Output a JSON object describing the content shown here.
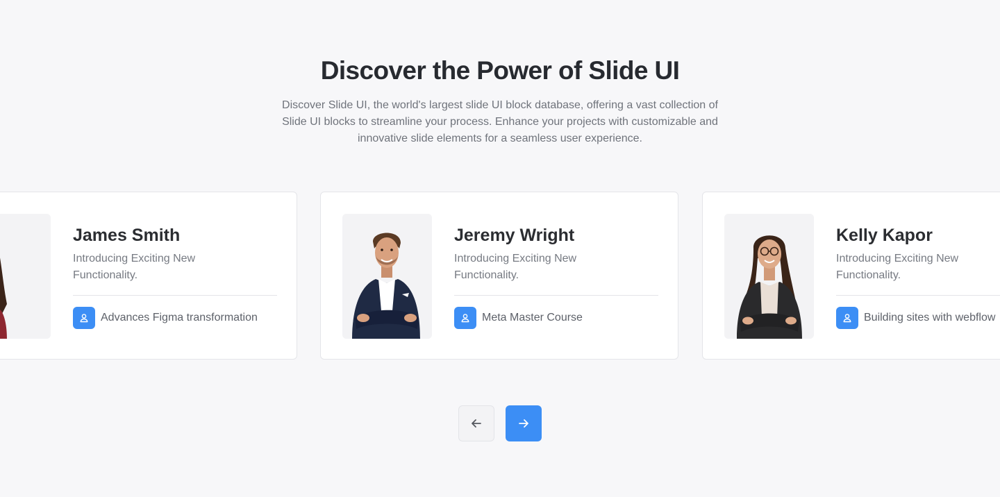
{
  "header": {
    "title": "Discover the Power of Slide UI",
    "description": "Discover Slide UI, the world's largest slide UI block database, offering a vast collection of Slide UI blocks to streamline your process. Enhance your projects with customizable and innovative slide elements for a seamless user experience."
  },
  "cards": [
    {
      "name": "James Smith",
      "tagline": "Introducing Exciting New Functionality.",
      "course": "Advances Figma transformation",
      "course_icon": "user-icon",
      "photo": "woman-in-red-blazer"
    },
    {
      "name": "Jeremy Wright",
      "tagline": "Introducing Exciting New Functionality.",
      "course": "Meta Master Course",
      "course_icon": "user-icon",
      "photo": "man-in-navy-suit"
    },
    {
      "name": "Kelly Kapor",
      "tagline": "Introducing Exciting New Functionality.",
      "course": "Building sites with webflow",
      "course_icon": "user-icon",
      "photo": "woman-with-glasses"
    }
  ],
  "navigation": {
    "prev_icon": "arrow-left-icon",
    "next_icon": "arrow-right-icon"
  },
  "colors": {
    "accent": "#3c8ef5",
    "background": "#f7f7f9",
    "card": "#ffffff"
  }
}
